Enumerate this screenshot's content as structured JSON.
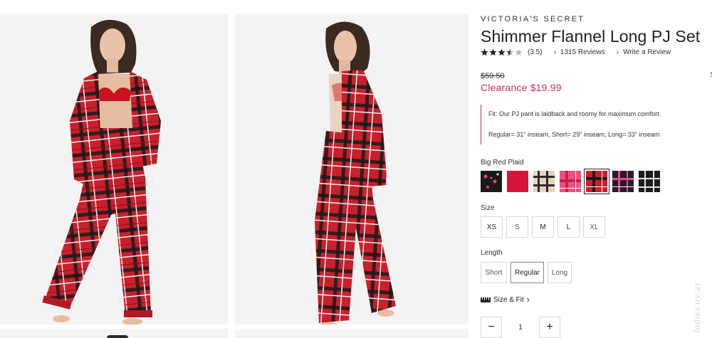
{
  "product": {
    "brand": "VICTORIA'S SECRET",
    "title": "Shimmer Flannel Long PJ Set",
    "rating_value": "(3.5)",
    "rating_fraction": 0.7,
    "reviews_link": "1315 Reviews",
    "write_review_link": "Write a Review",
    "old_price": "$59.50",
    "clearance_price": "Clearance $19.99",
    "edge_mark": "$"
  },
  "fit": {
    "line1": "Fit: Our PJ pant is laidback and roomy for maximum comfort.",
    "line2": "Regular= 31\" inseam, Short= 29\" inseam, Long= 33\" inseam"
  },
  "color": {
    "selected_label": "Big Red Plaid",
    "swatches": [
      {
        "name": "black-floral",
        "color": "#1a1a1a",
        "accent": "#e8467a"
      },
      {
        "name": "solid-red",
        "color": "#d8143a",
        "accent": "#b80f2e"
      },
      {
        "name": "tan-plaid",
        "color": "#e8d2bd",
        "accent": "#2b2b2b"
      },
      {
        "name": "pink-plaid",
        "color": "#f0507e",
        "accent": "#c81e52"
      },
      {
        "name": "big-red-plaid",
        "color": "#cc1f2e",
        "accent": "#1a1a1a"
      },
      {
        "name": "black-pink-plaid",
        "color": "#2a1a2a",
        "accent": "#e84d8a"
      },
      {
        "name": "black-white-plaid",
        "color": "#1c1c1c",
        "accent": "#e5e5e5"
      }
    ]
  },
  "size": {
    "label": "Size",
    "options": [
      "XS",
      "S",
      "M",
      "L",
      "XL"
    ]
  },
  "length": {
    "label": "Length",
    "options": [
      "Short",
      "Regular",
      "Long"
    ],
    "selected": "Regular"
  },
  "size_fit_link": "Size & Fit",
  "quantity": {
    "minus": "−",
    "value": "1",
    "plus": "+"
  },
  "watermark": "ladies.ay.uy",
  "theme": {
    "accent": "#c0306a",
    "plaid_red": "#c81e2a"
  }
}
